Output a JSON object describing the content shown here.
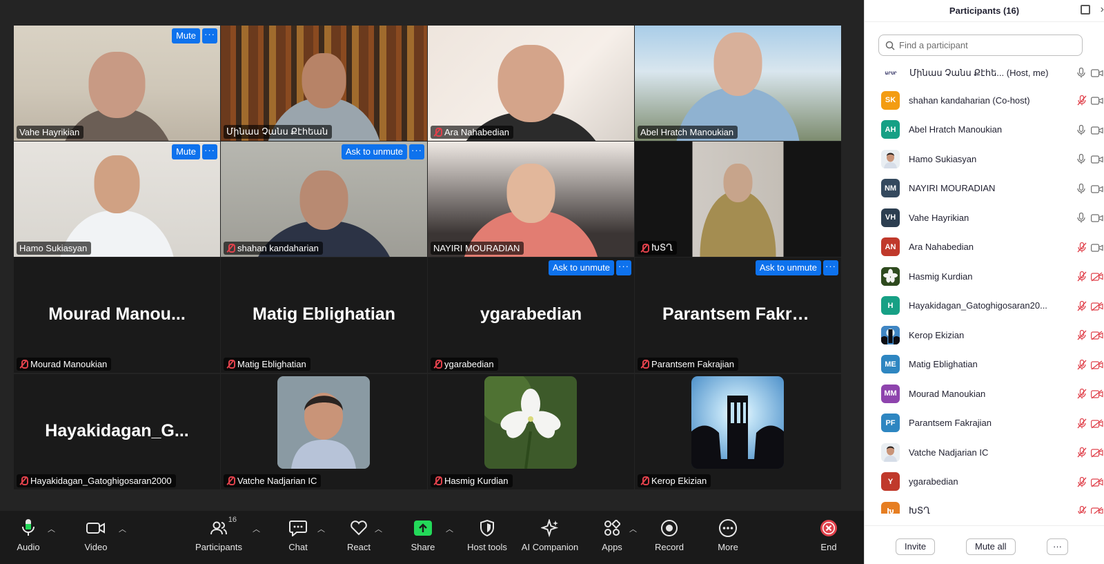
{
  "colors": {
    "accent": "#0e72ed",
    "active_speaker": "#23d959",
    "muted": "#e0414b",
    "toolbar_bg": "#1a1a1a",
    "gallery_bg": "#242424"
  },
  "tiles": [
    {
      "name": "Vahe Hayrikian",
      "muted": false,
      "actions": [
        "Mute",
        "···"
      ],
      "type": "video",
      "scene": "office"
    },
    {
      "name": "Մինաս Չանս Քէհեան",
      "muted": false,
      "active": true,
      "type": "video",
      "scene": "library"
    },
    {
      "name": "Ara Nahabedian",
      "muted": true,
      "type": "video",
      "scene": "lamp"
    },
    {
      "name": "Abel Hratch Manoukian",
      "muted": false,
      "type": "video",
      "scene": "outdoor"
    },
    {
      "name": "Hamo Sukiasyan",
      "muted": false,
      "actions": [
        "Mute",
        "···"
      ],
      "type": "video",
      "scene": "office2"
    },
    {
      "name": "shahan kandaharian",
      "muted": true,
      "actions": [
        "Ask to unmute",
        "···"
      ],
      "type": "video",
      "scene": "room"
    },
    {
      "name": "NAYIRI MOURADIAN",
      "muted": false,
      "type": "video",
      "scene": "sofa"
    },
    {
      "name": "ԽՏՂ",
      "muted": true,
      "type": "video",
      "scene": "portrait"
    },
    {
      "name": "Mourad Manoukian",
      "big": "Mourad  Manou...",
      "muted": true,
      "type": "name"
    },
    {
      "name": "Matig Eblighatian",
      "big": "Matig Eblighatian",
      "muted": true,
      "type": "name"
    },
    {
      "name": "ygarabedian",
      "big": "ygarabedian",
      "muted": true,
      "actions": [
        "Ask to unmute",
        "···"
      ],
      "type": "name"
    },
    {
      "name": "Parantsem Fakrajian",
      "big": "Parantsem  Fakra...",
      "muted": true,
      "actions": [
        "Ask to unmute",
        "···"
      ],
      "type": "name"
    },
    {
      "name": "Hayakidagan_Gatoghigosaran2000",
      "big": "Hayakidagan_G...",
      "muted": true,
      "type": "name"
    },
    {
      "name": "Vatche Nadjarian IC",
      "muted": true,
      "type": "avatar",
      "avatar": "man"
    },
    {
      "name": "Hasmig Kurdian",
      "muted": true,
      "type": "avatar",
      "avatar": "flower"
    },
    {
      "name": "Kerop Ekizian",
      "muted": true,
      "type": "avatar",
      "avatar": "monument"
    }
  ],
  "toolbar": {
    "audio": "Audio",
    "video": "Video",
    "participants": "Participants",
    "participants_count": "16",
    "chat": "Chat",
    "react": "React",
    "share": "Share",
    "host_tools": "Host tools",
    "ai_companion": "AI Companion",
    "apps": "Apps",
    "record": "Record",
    "more": "More",
    "end": "End"
  },
  "panel": {
    "title": "Participants (16)",
    "search_placeholder": "Find a participant",
    "invite": "Invite",
    "mute_all": "Mute all",
    "more": "···",
    "participants": [
      {
        "name": "Մինաս Չանս Քէհե...  (Host, me)",
        "initials": "ԱՐՍՐ",
        "color": "#ffffff",
        "pic": "logo",
        "mic": "on",
        "cam": "on"
      },
      {
        "name": "shahan kandaharian (Co-host)",
        "initials": "SK",
        "color": "#f39c12",
        "mic": "off",
        "cam": "on"
      },
      {
        "name": "Abel Hratch Manoukian",
        "initials": "AH",
        "color": "#16a085",
        "mic": "on",
        "cam": "on"
      },
      {
        "name": "Hamo Sukiasyan",
        "initials": "",
        "color": "#ffffff",
        "pic": "face",
        "mic": "on",
        "cam": "on"
      },
      {
        "name": "NAYIRI MOURADIAN",
        "initials": "NM",
        "color": "#34495e",
        "mic": "on",
        "cam": "on"
      },
      {
        "name": "Vahe Hayrikian",
        "initials": "VH",
        "color": "#2c3e50",
        "mic": "on",
        "cam": "on"
      },
      {
        "name": "Ara Nahabedian",
        "initials": "AN",
        "color": "#c0392b",
        "mic": "off",
        "cam": "on"
      },
      {
        "name": "Hasmig Kurdian",
        "initials": "",
        "color": "#2e4a1e",
        "pic": "flower",
        "mic": "off",
        "cam": "off"
      },
      {
        "name": "Hayakidagan_Gatoghigosaran20...",
        "initials": "H",
        "color": "#17a085",
        "mic": "off",
        "cam": "off"
      },
      {
        "name": "Kerop Ekizian",
        "initials": "",
        "color": "#2a3a55",
        "pic": "monument",
        "mic": "off",
        "cam": "off"
      },
      {
        "name": "Matig Eblighatian",
        "initials": "ME",
        "color": "#2e86c1",
        "mic": "off",
        "cam": "off"
      },
      {
        "name": "Mourad Manoukian",
        "initials": "MM",
        "color": "#8e44ad",
        "mic": "off",
        "cam": "off"
      },
      {
        "name": "Parantsem Fakrajian",
        "initials": "PF",
        "color": "#2e86c1",
        "mic": "off",
        "cam": "off"
      },
      {
        "name": "Vatche Nadjarian IC",
        "initials": "",
        "color": "#ffffff",
        "pic": "face",
        "mic": "off",
        "cam": "off"
      },
      {
        "name": "ygarabedian",
        "initials": "Y",
        "color": "#c0392b",
        "mic": "off",
        "cam": "off"
      },
      {
        "name": "ԽՏՂ",
        "initials": "Խ",
        "color": "#e67e22",
        "mic": "off",
        "cam": "off"
      }
    ]
  }
}
